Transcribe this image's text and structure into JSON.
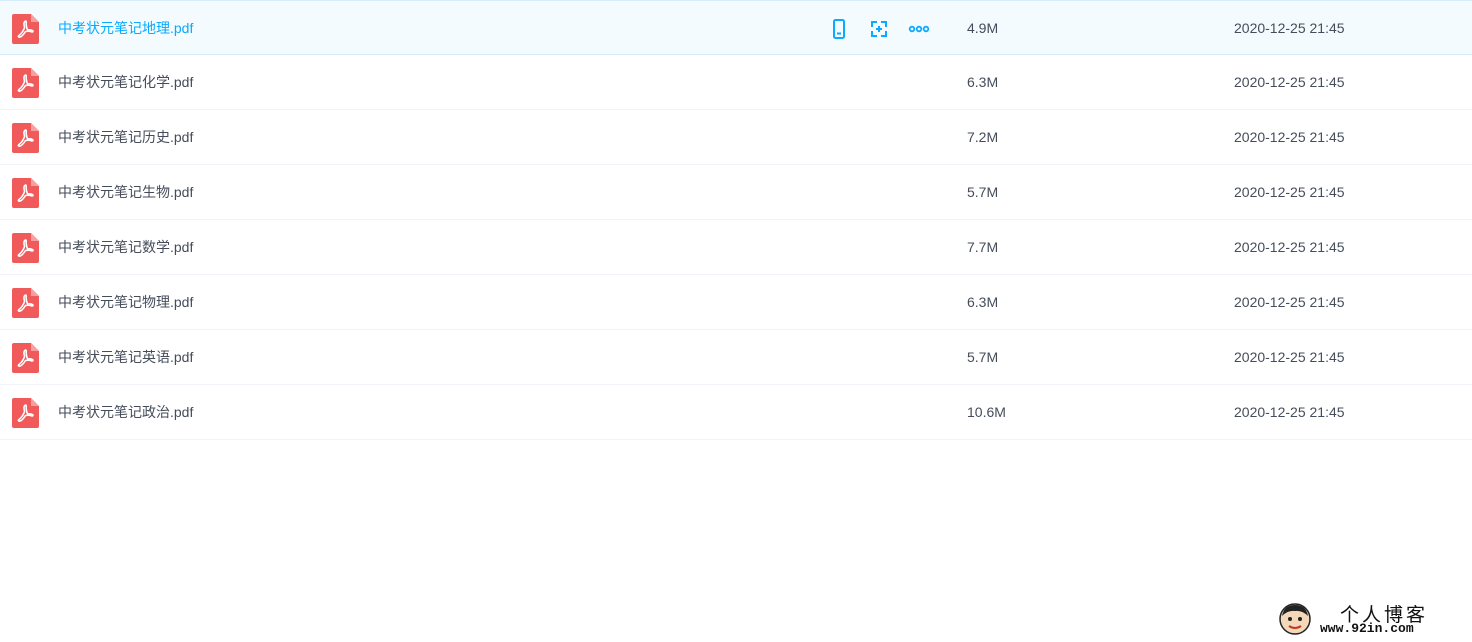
{
  "files": [
    {
      "name": "中考状元笔记地理.pdf",
      "size": "4.9M",
      "date": "2020-12-25 21:45",
      "selected": true
    },
    {
      "name": "中考状元笔记化学.pdf",
      "size": "6.3M",
      "date": "2020-12-25 21:45"
    },
    {
      "name": "中考状元笔记历史.pdf",
      "size": "7.2M",
      "date": "2020-12-25 21:45"
    },
    {
      "name": "中考状元笔记生物.pdf",
      "size": "5.7M",
      "date": "2020-12-25 21:45"
    },
    {
      "name": "中考状元笔记数学.pdf",
      "size": "7.7M",
      "date": "2020-12-25 21:45"
    },
    {
      "name": "中考状元笔记物理.pdf",
      "size": "6.3M",
      "date": "2020-12-25 21:45"
    },
    {
      "name": "中考状元笔记英语.pdf",
      "size": "5.7M",
      "date": "2020-12-25 21:45"
    },
    {
      "name": "中考状元笔记政治.pdf",
      "size": "10.6M",
      "date": "2020-12-25 21:45"
    }
  ],
  "row_actions": [
    {
      "icon": "phone-icon"
    },
    {
      "icon": "share-icon"
    },
    {
      "icon": "more-icon"
    }
  ],
  "watermark": {
    "title": "个人博客",
    "url": "www.92in.com"
  },
  "colors": {
    "accent": "#09aaff",
    "pdf_icon": "#f05a5a",
    "text": "#454d5a",
    "selected_bg": "#f3fbfe"
  }
}
